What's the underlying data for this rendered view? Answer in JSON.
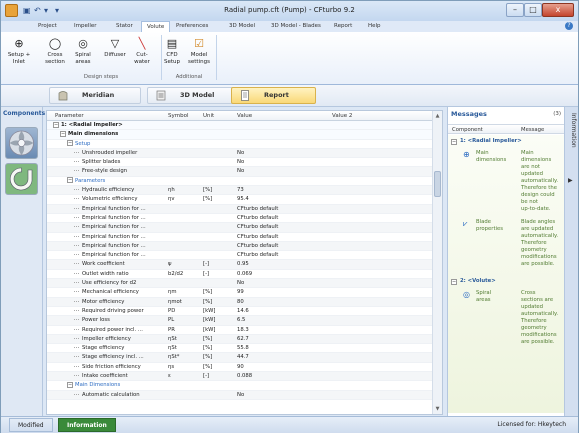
{
  "window": {
    "title": "Radial pump.cft (Pump) - CFturbo 9.2",
    "quick_access": [
      "↶",
      "▾",
      "▾"
    ],
    "buttons": {
      "minimize": "–",
      "maximize": "□",
      "close": "x"
    }
  },
  "menu": [
    "Project",
    "Impeller",
    "Stator",
    "Volute",
    "Preferences",
    "3D Model",
    "3D Model - Blades",
    "Report",
    "Help"
  ],
  "menu_active": "Volute",
  "help_icon": "?",
  "ribbon": {
    "design_steps": {
      "label": "Design steps",
      "buttons": [
        {
          "label": "Setup +",
          "label2": "Inlet",
          "icon": "⊕"
        },
        {
          "label": "Cross",
          "label2": "section",
          "icon": "◯"
        },
        {
          "label": "Spiral",
          "label2": "areas",
          "icon": "◎"
        },
        {
          "label": "Diffuser",
          "label2": "",
          "icon": "▽"
        },
        {
          "label": "Cut-",
          "label2": "water",
          "icon": "╲"
        }
      ]
    },
    "additional": {
      "label": "Additional",
      "buttons": [
        {
          "label": "CFD",
          "label2": "Setup",
          "icon": "▤"
        },
        {
          "label": "Model",
          "label2": "settings",
          "icon": "☑"
        }
      ]
    }
  },
  "view_tabs": [
    {
      "label": "Meridian",
      "icon": "meridian-icon"
    },
    {
      "label": "3D Model",
      "icon": "model-icon"
    },
    {
      "label": "Report",
      "icon": "report-icon"
    }
  ],
  "view_tab_active": "Report",
  "components_panel": {
    "title": "Components"
  },
  "grid": {
    "columns": [
      "Parameter",
      "Symbol",
      "Unit",
      "Value",
      "Value 2"
    ],
    "rows": [
      {
        "level": 0,
        "kind": "bold",
        "exp": "−",
        "label": "1: <Radial Impeller>",
        "sym": "",
        "unit": "",
        "val": ""
      },
      {
        "level": 1,
        "kind": "bold",
        "exp": "−",
        "label": "Main dimensions",
        "sym": "",
        "unit": "",
        "val": ""
      },
      {
        "level": 2,
        "kind": "sec",
        "exp": "−",
        "label": "Setup",
        "sym": "",
        "unit": "",
        "val": ""
      },
      {
        "level": 3,
        "kind": "",
        "exp": "",
        "label": "Unshrouded impeller",
        "sym": "",
        "unit": "",
        "val": "No"
      },
      {
        "level": 3,
        "kind": "",
        "exp": "",
        "label": "Splitter blades",
        "sym": "",
        "unit": "",
        "val": "No"
      },
      {
        "level": 3,
        "kind": "",
        "exp": "",
        "label": "Free-style design",
        "sym": "",
        "unit": "",
        "val": "No"
      },
      {
        "level": 2,
        "kind": "sec",
        "exp": "−",
        "label": "Parameters",
        "sym": "",
        "unit": "",
        "val": ""
      },
      {
        "level": 3,
        "kind": "",
        "exp": "",
        "label": "Hydraulic efficiency",
        "sym": "ηh",
        "unit": "[%]",
        "val": "73"
      },
      {
        "level": 3,
        "kind": "",
        "exp": "",
        "label": "Volumetric efficiency",
        "sym": "ηv",
        "unit": "[%]",
        "val": "95.4"
      },
      {
        "level": 3,
        "kind": "",
        "exp": "",
        "label": "Empirical function for ...",
        "sym": "",
        "unit": "",
        "val": "CFturbo default"
      },
      {
        "level": 3,
        "kind": "",
        "exp": "",
        "label": "Empirical function for ...",
        "sym": "",
        "unit": "",
        "val": "CFturbo default"
      },
      {
        "level": 3,
        "kind": "",
        "exp": "",
        "label": "Empirical function for ...",
        "sym": "",
        "unit": "",
        "val": "CFturbo default"
      },
      {
        "level": 3,
        "kind": "",
        "exp": "",
        "label": "Empirical function for ...",
        "sym": "",
        "unit": "",
        "val": "CFturbo default"
      },
      {
        "level": 3,
        "kind": "",
        "exp": "",
        "label": "Empirical function for ...",
        "sym": "",
        "unit": "",
        "val": "CFturbo default"
      },
      {
        "level": 3,
        "kind": "",
        "exp": "",
        "label": "Empirical function for ...",
        "sym": "",
        "unit": "",
        "val": "CFturbo default"
      },
      {
        "level": 3,
        "kind": "",
        "exp": "",
        "label": "Work coefficient",
        "sym": "ψ",
        "unit": "[-]",
        "val": "0.95"
      },
      {
        "level": 3,
        "kind": "",
        "exp": "",
        "label": "Outlet width ratio",
        "sym": "b2/d2",
        "unit": "[-]",
        "val": "0.069"
      },
      {
        "level": 3,
        "kind": "",
        "exp": "",
        "label": "Use efficiency for d2",
        "sym": "",
        "unit": "",
        "val": "No"
      },
      {
        "level": 3,
        "kind": "",
        "exp": "",
        "label": "Mechanical efficiency",
        "sym": "ηm",
        "unit": "[%]",
        "val": "99"
      },
      {
        "level": 3,
        "kind": "",
        "exp": "",
        "label": "Motor efficiency",
        "sym": "ηmot",
        "unit": "[%]",
        "val": "80"
      },
      {
        "level": 3,
        "kind": "",
        "exp": "",
        "label": "Required driving power",
        "sym": "PD",
        "unit": "[kW]",
        "val": "14.6"
      },
      {
        "level": 3,
        "kind": "",
        "exp": "",
        "label": "Power loss",
        "sym": "PL",
        "unit": "[kW]",
        "val": "6.5"
      },
      {
        "level": 3,
        "kind": "",
        "exp": "",
        "label": "Required power incl. ...",
        "sym": "PR",
        "unit": "[kW]",
        "val": "18.3"
      },
      {
        "level": 3,
        "kind": "",
        "exp": "",
        "label": "Impeller efficiency",
        "sym": "ηSt",
        "unit": "[%]",
        "val": "62.7"
      },
      {
        "level": 3,
        "kind": "",
        "exp": "",
        "label": "Stage efficiency",
        "sym": "ηSt",
        "unit": "[%]",
        "val": "55.8"
      },
      {
        "level": 3,
        "kind": "",
        "exp": "",
        "label": "Stage efficiency incl. ...",
        "sym": "ηSt*",
        "unit": "[%]",
        "val": "44.7"
      },
      {
        "level": 3,
        "kind": "",
        "exp": "",
        "label": "Side friction efficiency",
        "sym": "ηs",
        "unit": "[%]",
        "val": "90"
      },
      {
        "level": 3,
        "kind": "",
        "exp": "",
        "label": "Intake coefficient",
        "sym": "ε",
        "unit": "[-]",
        "val": "0.088"
      },
      {
        "level": 2,
        "kind": "sec",
        "exp": "−",
        "label": "Main Dimensions",
        "sym": "",
        "unit": "",
        "val": ""
      },
      {
        "level": 3,
        "kind": "",
        "exp": "",
        "label": "Automatic calculation",
        "sym": "",
        "unit": "",
        "val": "No"
      }
    ]
  },
  "messages": {
    "title": "Messages",
    "count": "(3)",
    "columns": [
      "Component",
      "Message"
    ],
    "groups": [
      {
        "title": "1: <Radial Impeller>",
        "items": [
          {
            "component": [
              "Main",
              "dimensions"
            ],
            "message": [
              "Main",
              "dimensions",
              "are not",
              "updated",
              "automatically.",
              "Therefore the",
              "design could",
              "be not",
              "up-to-date."
            ]
          },
          {
            "component": [
              "Blade",
              "properties"
            ],
            "message": [
              "Blade angles",
              "are updated",
              "automatically.",
              "Therefore",
              "geometry",
              "modifications",
              "are possible."
            ]
          }
        ]
      },
      {
        "title": "2: <Volute>",
        "items": [
          {
            "component": [
              "Spiral",
              "areas"
            ],
            "message": [
              "Cross",
              "sections are",
              "updated",
              "automatically.",
              "Therefore",
              "geometry",
              "modifications",
              "are possible."
            ]
          }
        ]
      }
    ]
  },
  "info_sidebar": {
    "label": "Information"
  },
  "statusbar": {
    "tabs": [
      "Modified",
      "Information"
    ],
    "active_tab": "Information",
    "license": "Licensed for: Hkeytech"
  },
  "colors": {
    "accent": "#2a5a9a",
    "message_text": "#4f7a2f",
    "active_view_tab": "#f9d878",
    "status_info": "#3a8a3a"
  }
}
